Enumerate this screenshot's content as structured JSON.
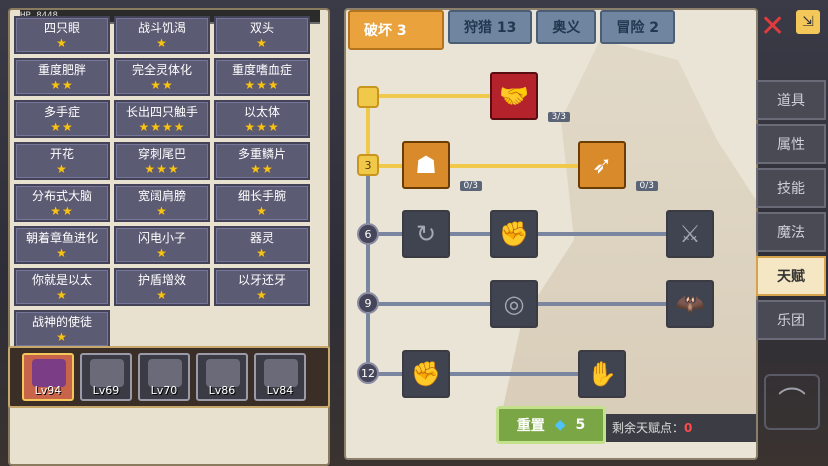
{
  "player": {
    "hp_label": "HP",
    "hp_value": "8448"
  },
  "mutations": [
    {
      "name": "四只眼",
      "stars": 1
    },
    {
      "name": "战斗饥渴",
      "stars": 1
    },
    {
      "name": "双头",
      "stars": 1
    },
    {
      "name": "重度肥胖",
      "stars": 2
    },
    {
      "name": "完全灵体化",
      "stars": 2
    },
    {
      "name": "重度嗜血症",
      "stars": 3
    },
    {
      "name": "多手症",
      "stars": 2
    },
    {
      "name": "长出四只触手",
      "stars": 4
    },
    {
      "name": "以太体",
      "stars": 3
    },
    {
      "name": "开花",
      "stars": 1
    },
    {
      "name": "穿刺尾巴",
      "stars": 3
    },
    {
      "name": "多重鳞片",
      "stars": 2
    },
    {
      "name": "分布式大脑",
      "stars": 2
    },
    {
      "name": "宽阔肩膀",
      "stars": 1
    },
    {
      "name": "细长手腕",
      "stars": 1
    },
    {
      "name": "朝着章鱼进化",
      "stars": 1
    },
    {
      "name": "闪电小子",
      "stars": 1
    },
    {
      "name": "器灵",
      "stars": 1
    },
    {
      "name": "你就是以太",
      "stars": 1
    },
    {
      "name": "护盾增效",
      "stars": 1
    },
    {
      "name": "以牙还牙",
      "stars": 1
    },
    {
      "name": "战神的使徒",
      "stars": 1
    }
  ],
  "characters": [
    {
      "level": "Lv94",
      "selected": true
    },
    {
      "level": "Lv69",
      "selected": false
    },
    {
      "level": "Lv70",
      "selected": false
    },
    {
      "level": "Lv86",
      "selected": false
    },
    {
      "level": "Lv84",
      "selected": false
    }
  ],
  "tabs": [
    {
      "label": "破坏 3",
      "active": true
    },
    {
      "label": "狩猎 13",
      "active": false
    },
    {
      "label": "奥义",
      "active": false
    },
    {
      "label": "冒险 2",
      "active": false
    }
  ],
  "talent_tree": {
    "level_markers": [
      "3",
      "6",
      "9",
      "12"
    ],
    "talents": [
      {
        "name": "arm-wrestle-talent",
        "icon": "arm-wrestle-icon",
        "count": "3/3"
      },
      {
        "name": "body-talent",
        "icon": "body-icon",
        "count": "0/3"
      },
      {
        "name": "arrow-talent",
        "icon": "arrow-icon",
        "count": "0/3"
      }
    ]
  },
  "reset": {
    "label": "重置",
    "gem_count": "5"
  },
  "remaining_points": {
    "label": "剩余天赋点：",
    "value": "0"
  },
  "side_tabs": [
    {
      "label": "道具",
      "active": false
    },
    {
      "label": "属性",
      "active": false
    },
    {
      "label": "技能",
      "active": false
    },
    {
      "label": "魔法",
      "active": false
    },
    {
      "label": "天赋",
      "active": true
    },
    {
      "label": "乐团",
      "active": false
    }
  ],
  "colors": {
    "accent": "#e9a23c",
    "star": "#f5c31a",
    "points": "#ff4b4b"
  }
}
